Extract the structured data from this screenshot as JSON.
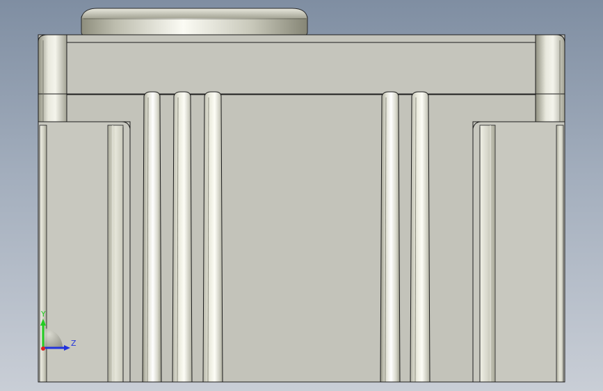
{
  "viewport": {
    "background_top": "#7f8ea2",
    "background_bottom": "#c9ced6"
  },
  "model": {
    "face_color": "#c3c3ba",
    "edge_color": "#1c1c1c",
    "highlight_color": "#ffffff",
    "shadow_color": "#7d7d6f"
  },
  "triad": {
    "y_label": "Y",
    "z_label": "Z",
    "y_color": "#22cc22",
    "z_color": "#2233dd",
    "x_color": "#dd2222"
  }
}
